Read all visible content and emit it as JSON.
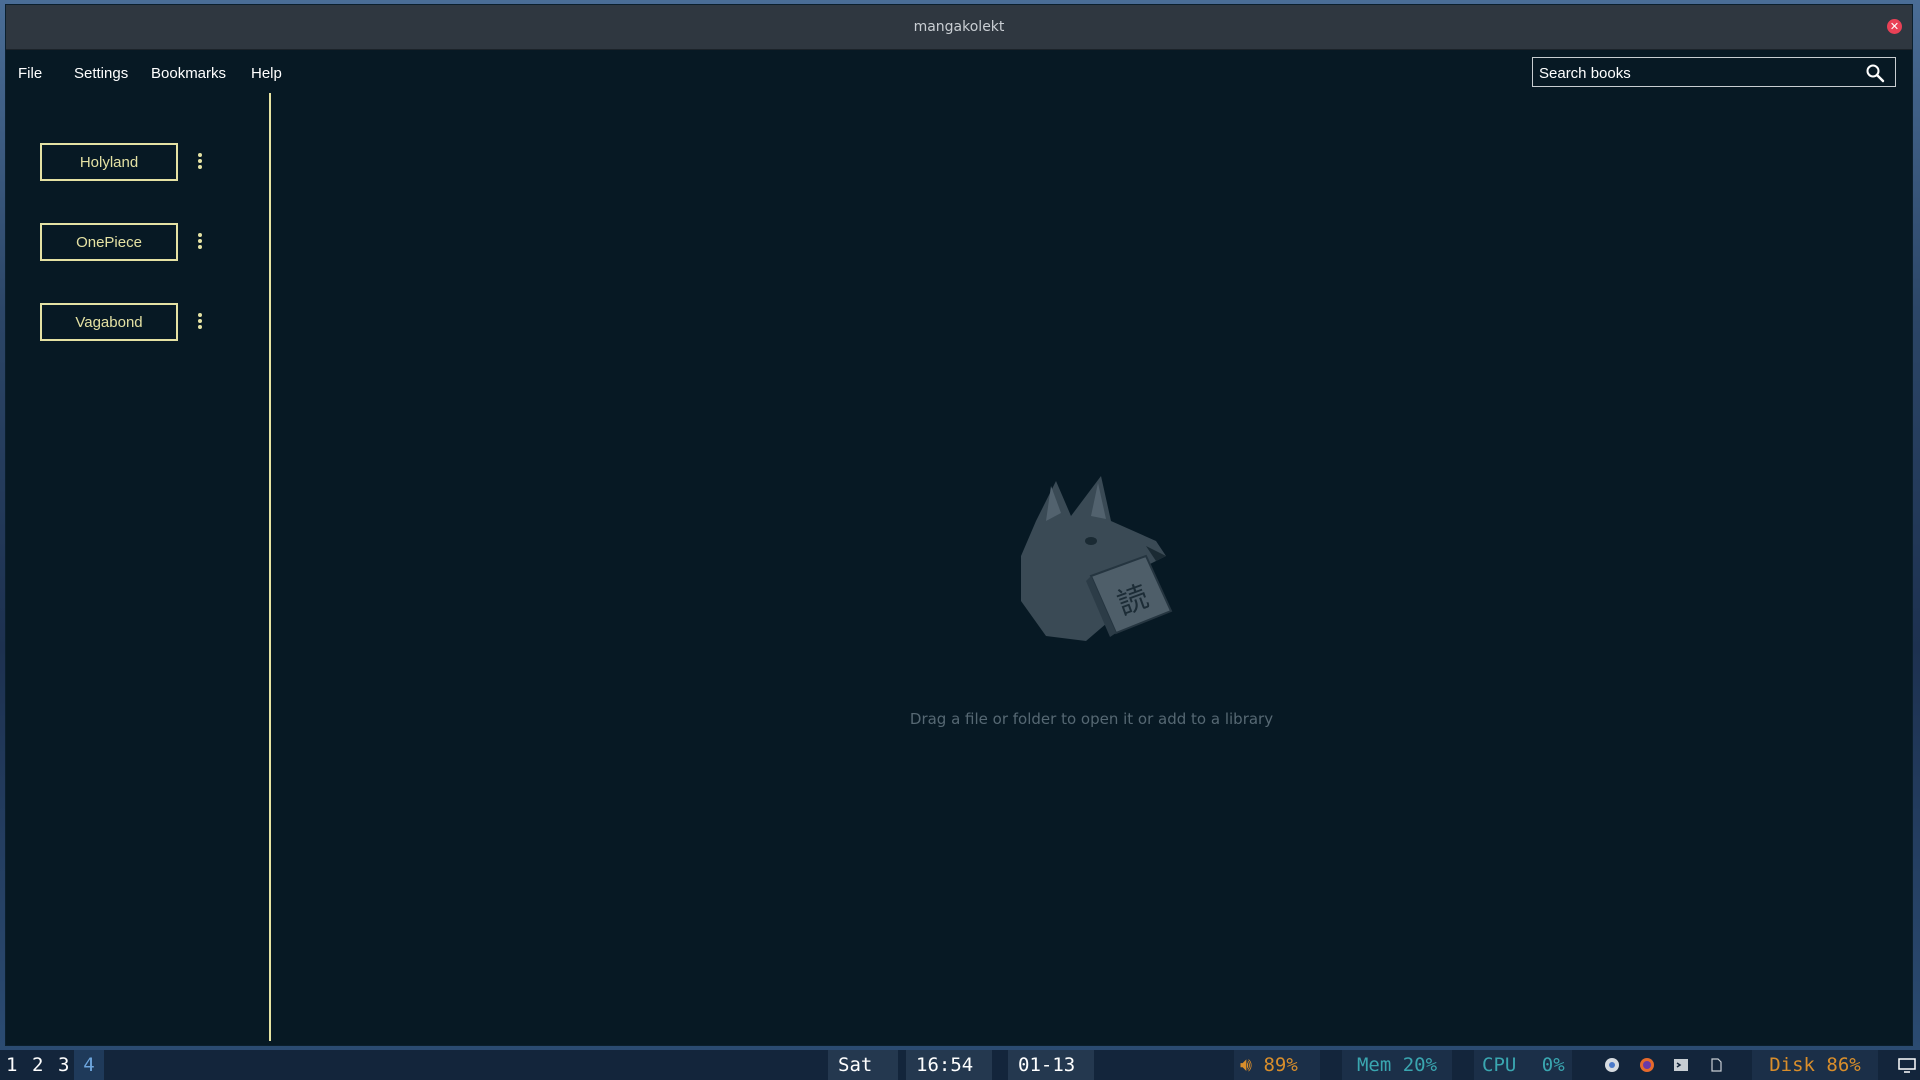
{
  "window": {
    "title": "mangakolekt",
    "close_glyph": "✕"
  },
  "menu": {
    "items": [
      "File",
      "Settings",
      "Bookmarks",
      "Help"
    ]
  },
  "search": {
    "placeholder": "Search books",
    "icon": "search-icon"
  },
  "libraries": [
    {
      "label": "Holyland"
    },
    {
      "label": "OnePiece"
    },
    {
      "label": "Vagabond"
    }
  ],
  "main": {
    "empty_message": "Drag a file or folder to open it or add to a library",
    "mascot_glyph": "読"
  },
  "taskbar": {
    "workspaces": [
      "1",
      "2",
      "3",
      "4"
    ],
    "active_workspace": "4",
    "day": "Sat",
    "time": "16:54",
    "date": "01-13",
    "volume": "89%",
    "memory": "Mem 20%",
    "cpu_label": "CPU",
    "cpu_value": "0%",
    "disk": "Disk 86%",
    "tray_icons": [
      "chrome-icon",
      "firefox-icon",
      "terminal-icon",
      "file-icon"
    ]
  },
  "colors": {
    "accent": "#e4e1a3",
    "background": "#071924",
    "taskbar_orange": "#d98e2b",
    "taskbar_teal": "#3aa6b0"
  }
}
